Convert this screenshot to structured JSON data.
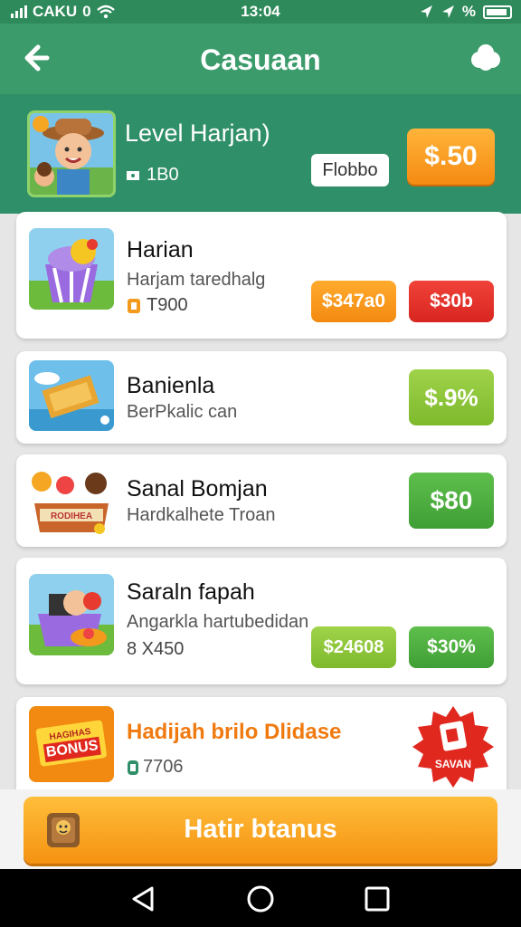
{
  "status_bar": {
    "carrier": "CAKU",
    "network": "0",
    "time": "13:04",
    "battery": "%"
  },
  "header": {
    "title": "Casuaan"
  },
  "hero": {
    "title": "Level Harjan)",
    "sub": "1B0",
    "pill": "Flobbo",
    "price": "$.50"
  },
  "cards": [
    {
      "title": "Harian",
      "subtitle": "Harjam taredhalg",
      "meta": "T900",
      "btn1": "$347a0",
      "btn2": "$30b"
    },
    {
      "title": "Banienla",
      "subtitle": "BerPkalic can",
      "btn1": "$.9%"
    },
    {
      "title": "Sanal Bomjan",
      "subtitle": "Hardkalhete Troan",
      "btn1": "$80",
      "thumb_label": "RODIHEA"
    },
    {
      "title": "Saraln fapah",
      "subtitle": "Angarkla hartubedidan",
      "meta": "8 X450",
      "btn1": "$24608",
      "btn2": "$30%"
    }
  ],
  "bonus": {
    "title": "Hadijah brilo Dlidase",
    "meta": "7706",
    "badge_label": "BONUS",
    "badge_top": "HAGIHAS",
    "sticker": "SAVAN"
  },
  "cta": {
    "label": "Hatir btanus"
  },
  "colors": {
    "header": "#3b9b6b",
    "hero": "#2f8f68",
    "orange": "#f59212",
    "red": "#d8251f",
    "lime": "#8cc63f",
    "green": "#4caf45"
  }
}
